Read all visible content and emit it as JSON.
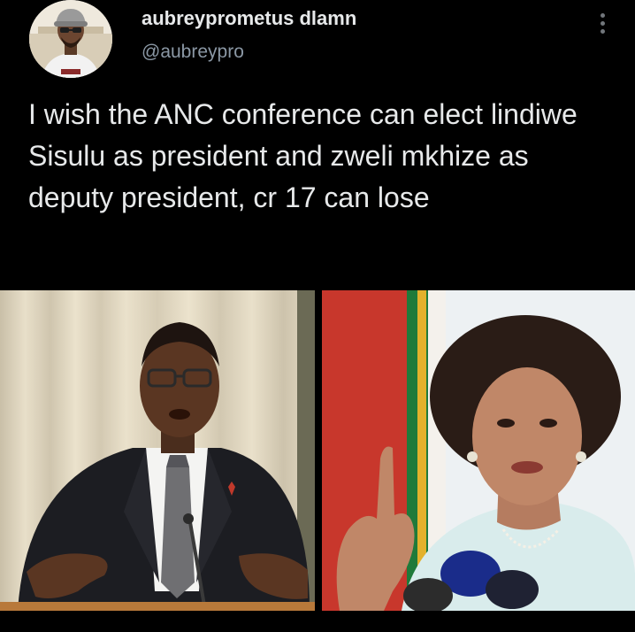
{
  "tweet": {
    "author": {
      "display_name": "aubreyprometus dlamn",
      "handle": "@aubreypro",
      "avatar_icon": "profile-photo"
    },
    "text": "I wish the ANC conference can elect lindiwe Sisulu as president and zweli mkhize as deputy president, cr 17 can lose",
    "more_icon": "more-vertical-icon",
    "media": [
      {
        "name": "photo-man-in-suit-speaking"
      },
      {
        "name": "photo-woman-raising-finger"
      }
    ]
  },
  "colors": {
    "background": "#000000",
    "text": "#e7e9ea",
    "secondary_text": "#8b98a5"
  }
}
